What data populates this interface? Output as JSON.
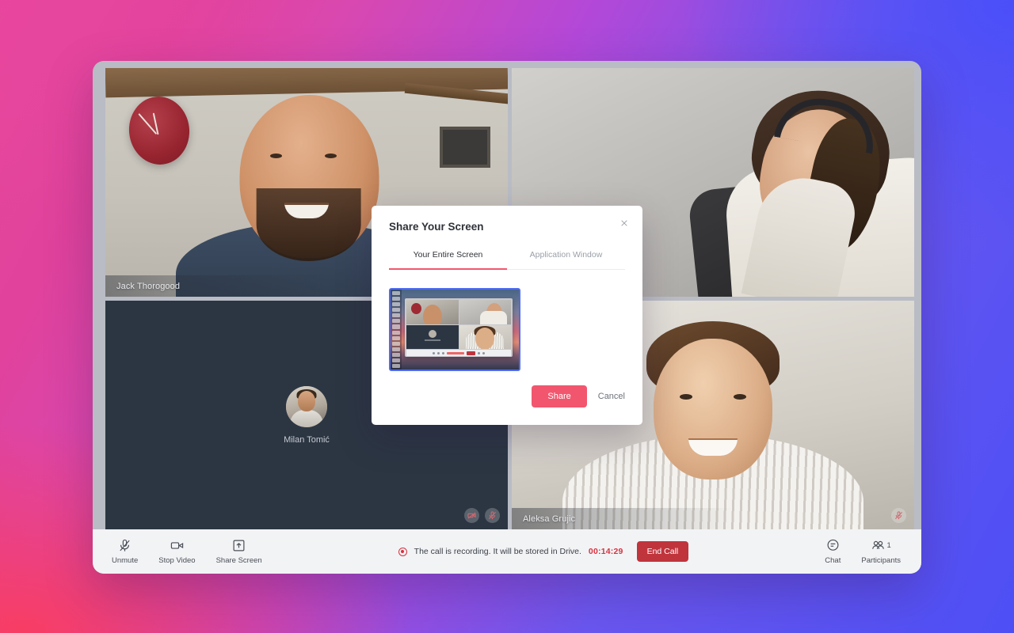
{
  "app": {
    "participants": [
      {
        "name": "Jack Thorogood",
        "badges": []
      },
      {
        "name": "",
        "badges": []
      },
      {
        "name": "Milan Tomić",
        "badges": [
          "video-off-icon",
          "mic-off-icon"
        ],
        "placeholder": true
      },
      {
        "name": "Aleksa Grujic",
        "badges": [
          "mic-off-icon"
        ]
      }
    ]
  },
  "toolbar": {
    "left": [
      {
        "icon": "mic-off-icon",
        "label": "Unmute"
      },
      {
        "icon": "video-camera-icon",
        "label": "Stop Video"
      },
      {
        "icon": "share-screen-icon",
        "label": "Share Screen"
      }
    ],
    "recording": {
      "text": "The call is recording. It will be stored in Drive.",
      "time": "00:14:29",
      "end_call_label": "End Call",
      "indicator_color": "#d7323f"
    },
    "right": [
      {
        "icon": "chat-icon",
        "label": "Chat"
      },
      {
        "icon": "participants-icon",
        "label": "Participants",
        "count": "1"
      }
    ]
  },
  "modal": {
    "title": "Share Your Screen",
    "close_icon": "close-icon",
    "tabs": [
      {
        "label": "Your Entire Screen",
        "active": true
      },
      {
        "label": "Application Window",
        "active": false
      }
    ],
    "share_label": "Share",
    "cancel_label": "Cancel",
    "accent_color": "#f2566e",
    "selection_color": "#4f6cf0"
  }
}
